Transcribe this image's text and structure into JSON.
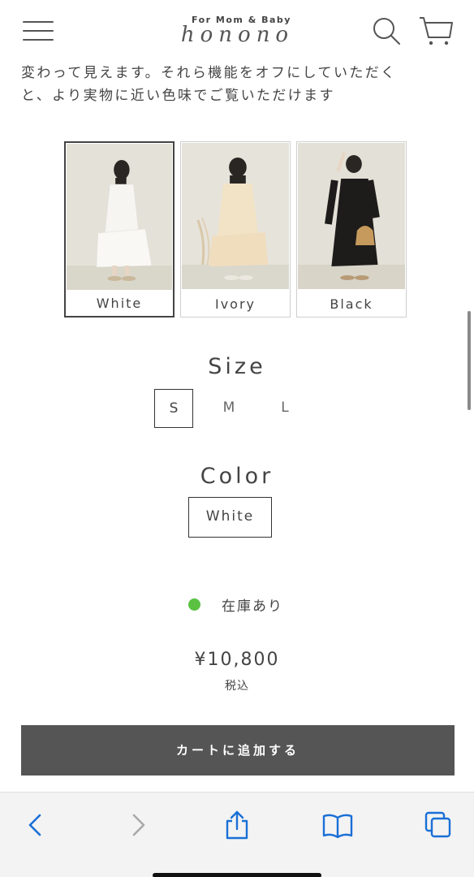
{
  "header": {
    "logo_sub": "For Mom & Baby",
    "logo_main": "honono"
  },
  "intro": {
    "line1": "変わって見えます。それら機能をオフにしていただく",
    "line2": "と、より実物に近い色味でご覧いただけます"
  },
  "swatches": [
    {
      "label": "White",
      "selected": true
    },
    {
      "label": "Ivory",
      "selected": false
    },
    {
      "label": "Black",
      "selected": false
    }
  ],
  "size": {
    "title": "Size",
    "options": [
      "S",
      "M",
      "L"
    ],
    "selected": "S"
  },
  "color": {
    "title": "Color",
    "selected_label": "White"
  },
  "stock": {
    "text": "在庫あり",
    "dot_color": "#5ac142"
  },
  "price": {
    "amount": "¥10,800",
    "tax_note": "税込"
  },
  "cart": {
    "button_label": "カートに追加する"
  },
  "colors": {
    "accent": "#555555",
    "link_blue": "#1a6fd6",
    "in_stock": "#5ac142"
  },
  "icons": {
    "menu": "hamburger-menu-icon",
    "search": "search-icon",
    "cart": "cart-icon",
    "back": "chevron-left-icon",
    "forward": "chevron-right-icon",
    "share": "share-icon",
    "bookmarks": "book-icon",
    "tabs": "tabs-icon"
  }
}
